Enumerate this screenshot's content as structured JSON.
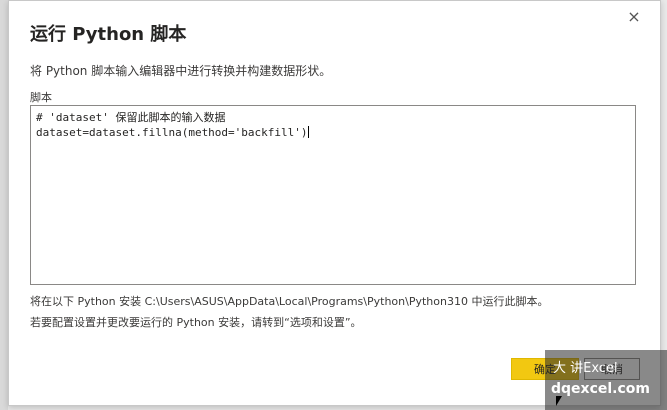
{
  "dialog": {
    "title": "运行 Python 脚本",
    "subtitle": "将 Python 脚本输入编辑器中进行转换并构建数据形状。",
    "script_label": "脚本",
    "close_icon": "×",
    "editor": {
      "lines": [
        "# 'dataset' 保留此脚本的输入数据",
        "dataset=dataset.fillna(method='backfill')"
      ]
    },
    "notes": [
      "将在以下 Python 安装 C:\\Users\\ASUS\\AppData\\Local\\Programs\\Python\\Python310 中运行此脚本。",
      "若要配置设置并更改要运行的 Python 安装，请转到“选项和设置”。"
    ],
    "buttons": {
      "ok_label": "确定",
      "cancel_label": "取消"
    }
  },
  "watermark": {
    "line1": "大 讲Excel",
    "line2": "dqexcel.com"
  },
  "colors": {
    "primary_button": "#f2c811",
    "text": "#252423"
  }
}
